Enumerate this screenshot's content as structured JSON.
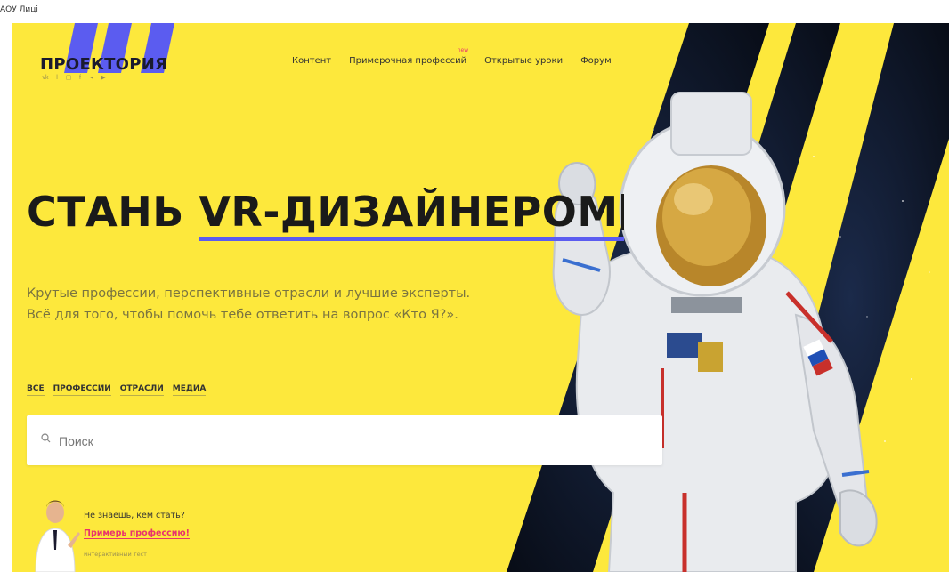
{
  "browser": {
    "tab_title": "АОУ Лицi"
  },
  "logo": {
    "text": "ПРОЕКТОРИЯ",
    "socials": [
      "vk-icon",
      "ok-icon",
      "instagram-icon",
      "facebook-icon",
      "telegram-icon",
      "youtube-icon"
    ]
  },
  "nav": {
    "items": [
      {
        "label": "Контент"
      },
      {
        "label": "Примерочная профессий",
        "badge": "new"
      },
      {
        "label": "Открытые уроки"
      },
      {
        "label": "Форум"
      }
    ]
  },
  "hero": {
    "headline_prefix": "СТАНЬ ",
    "headline_accent": "VR-ДИЗАЙНЕРОМ",
    "subtitle_line1": "Крутые профессии, перспективные отрасли и лучшие эксперты.",
    "subtitle_line2": "Всё для того, чтобы помочь тебе ответить на вопрос «Кто Я?»."
  },
  "filters": [
    "ВСЕ",
    "ПРОФЕССИИ",
    "ОТРАСЛИ",
    "МЕДИА"
  ],
  "search": {
    "placeholder": "Поиск"
  },
  "promo": {
    "question": "Не знаешь, кем стать?",
    "cta": "Примерь профессию!",
    "note": "интерактивный тест"
  },
  "colors": {
    "background": "#fde83c",
    "accent": "#5b5cf0",
    "link_pink": "#e8336d",
    "stripe_dark": "#0b1020"
  }
}
